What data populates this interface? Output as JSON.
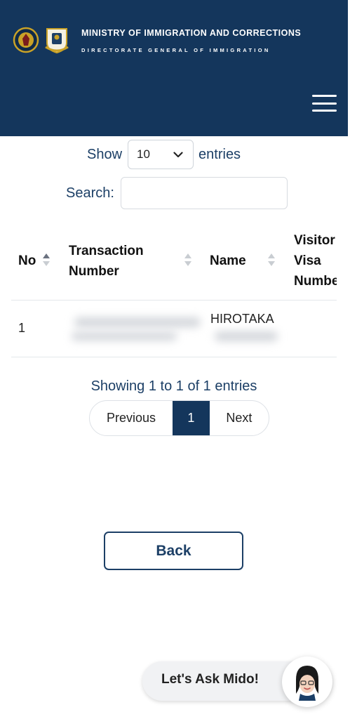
{
  "header": {
    "title": "MINISTRY OF IMMIGRATION AND CORRECTIONS",
    "subtitle": "DIRECTORATE GENERAL OF IMMIGRATION",
    "menu_icon": "hamburger-icon",
    "logos": [
      "garuda-emblem-logo",
      "immigration-logo"
    ],
    "colors": {
      "navy": "#14365c",
      "text_blue": "#1c3f66"
    }
  },
  "length_control": {
    "show_label": "Show",
    "selected": "10",
    "entries_label": "entries"
  },
  "search": {
    "label": "Search:",
    "value": "",
    "placeholder": ""
  },
  "table": {
    "columns": [
      {
        "label": "No",
        "sort": "ascending"
      },
      {
        "label_lines": [
          "Transaction",
          "Number"
        ],
        "sort": "none"
      },
      {
        "label": "Name",
        "sort": "none"
      },
      {
        "label_lines": [
          "Visitor",
          "Visa",
          "Number"
        ],
        "sort": "none"
      }
    ],
    "rows": [
      {
        "no": "1",
        "name": "HIROTAKA"
      }
    ]
  },
  "pagination": {
    "info": "Showing 1 to 1 of 1 entries",
    "previous": "Previous",
    "current": "1",
    "next": "Next"
  },
  "back_label": "Back",
  "chat": {
    "label": "Let's Ask Mido!",
    "avatar_icon": "mido-assistant-avatar-icon"
  }
}
